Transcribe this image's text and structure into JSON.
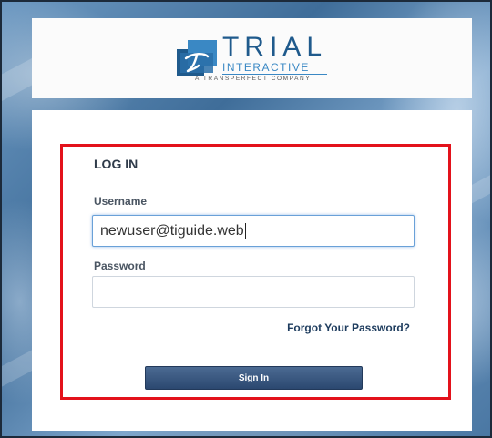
{
  "brand": {
    "name": "TRIAL",
    "sub": "INTERACTIVE",
    "tagline": "A TRANSPERFECT COMPANY",
    "primary_color": "#1f5a8c",
    "secondary_color": "#3a88c4"
  },
  "login": {
    "title": "LOG IN",
    "username_label": "Username",
    "username_value": "newuser@tiguide.web",
    "password_label": "Password",
    "password_value": "",
    "forgot_link": "Forgot Your Password?",
    "signin_label": "Sign In",
    "highlight_color": "#e3121b"
  }
}
